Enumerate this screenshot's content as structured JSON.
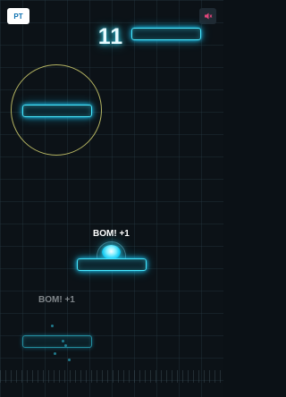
{
  "hud": {
    "language_label": "PT",
    "score": "11",
    "sound_state": "muted"
  },
  "popups": [
    {
      "text": "BOM! +1"
    },
    {
      "text": "BOM! +1"
    }
  ],
  "colors": {
    "platform_glow": "#46e8ff",
    "ring": "#c8c66a",
    "background": "#0c1217"
  },
  "icons": {
    "sound": "speaker-muted-icon"
  }
}
